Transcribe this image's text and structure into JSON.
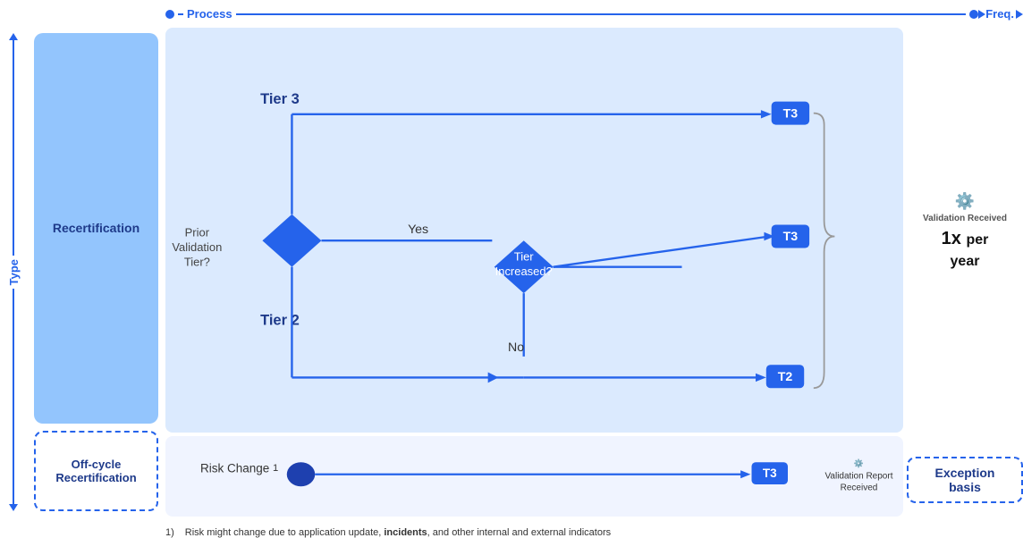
{
  "header": {
    "process_label": "Process",
    "freq_label": "Freq."
  },
  "type_label": "Type",
  "recertification": {
    "main_label": "Recertification",
    "offcycle_label": "Off-cycle\nRecertification"
  },
  "freq": {
    "value": "1x",
    "unit": "per\nyear"
  },
  "exception_box": {
    "label": "Exception\nbasis"
  },
  "badges": {
    "t3": "T3",
    "t2": "T2"
  },
  "diagram": {
    "tier3_label": "Tier 3",
    "tier2_label": "Tier 2",
    "prior_validation_label": "Prior\nValidation\nTier?",
    "tier_increased_label": "Tier\nIncreased?",
    "yes_label": "Yes",
    "no_label": "No",
    "validation_received_label": "Validation\nReceived",
    "validation_report_received_label": "Validation Report\nReceived",
    "risk_change_label": "Risk Change"
  },
  "footnote": {
    "number": "1)",
    "text": "Risk might change due to application update, ",
    "bold": "incidents",
    "text2": ", and other internal and external indicators"
  }
}
